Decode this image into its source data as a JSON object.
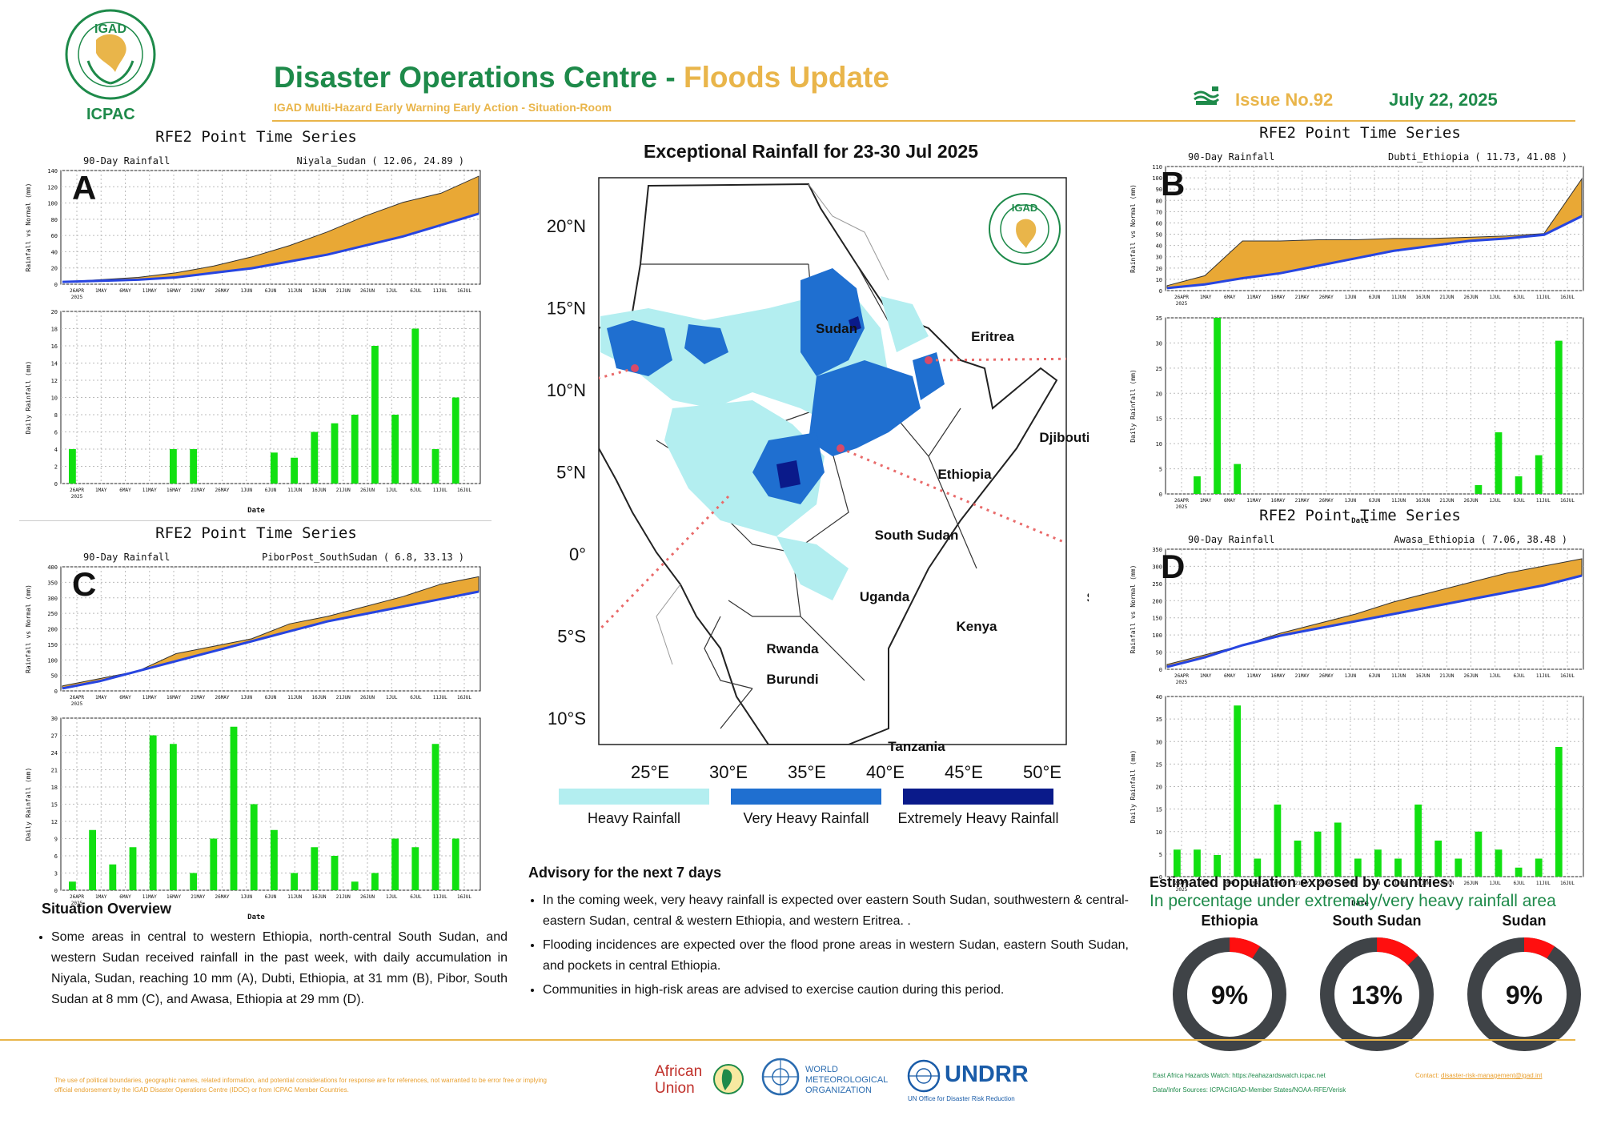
{
  "header": {
    "logo_org": "ICPAC",
    "logo_badge": "IGAD",
    "title_main": "Disaster Operations Centre - ",
    "title_highlight": "Floods Update",
    "subtitle": "IGAD Multi-Hazard Early Warning Early Action - Situation-Room",
    "issue": "Issue No.92",
    "date": "July 22, 2025"
  },
  "map": {
    "title": "Exceptional Rainfall for 23-30 Jul 2025",
    "lat_labels": [
      "20°N",
      "15°N",
      "10°N",
      "5°N",
      "0°",
      "5°S",
      "10°S"
    ],
    "lon_labels": [
      "25°E",
      "30°E",
      "35°E",
      "40°E",
      "45°E",
      "50°E"
    ],
    "countries": [
      "Sudan",
      "Eritrea",
      "Djibouti",
      "Ethiopia",
      "South Sudan",
      "Somalia",
      "Uganda",
      "Kenya",
      "Rwanda",
      "Burundi",
      "Tanzania"
    ],
    "legend": [
      {
        "label": "Heavy Rainfall",
        "color": "#b3eef0"
      },
      {
        "label": "Very Heavy Rainfall",
        "color": "#1f6fd0"
      },
      {
        "label": "Extremely Heavy Rainfall",
        "color": "#0a1a8a"
      }
    ],
    "badge": "IGAD"
  },
  "panels": [
    {
      "letter": "A",
      "heading": "RFE2 Point Time Series",
      "left_label": "90-Day Rainfall",
      "station": "Niyala_Sudan ( 12.06, 24.89 )",
      "ylabel_top": "Rainfall vs Normal (mm)",
      "ylabel_bottom": "Daily Rainfall (mm)",
      "xlabel": "Date",
      "top_ticks": [
        "0",
        "20",
        "40",
        "60",
        "80",
        "100",
        "120",
        "140"
      ],
      "bottom_ticks": [
        "0",
        "2",
        "4",
        "6",
        "8",
        "10",
        "12",
        "14",
        "16",
        "18",
        "20"
      ],
      "dates": [
        "26APR",
        "1MAY",
        "6MAY",
        "11MAY",
        "16MAY",
        "21MAY",
        "26MAY",
        "1JUN",
        "6JUN",
        "11JUN",
        "16JUN",
        "21JUN",
        "26JUN",
        "1JUL",
        "6JUL",
        "11JUL",
        "16JUL"
      ],
      "year": "2025"
    },
    {
      "letter": "B",
      "heading": "RFE2 Point Time Series",
      "left_label": "90-Day Rainfall",
      "station": "Dubti_Ethiopia ( 11.73, 41.08 )",
      "ylabel_top": "Rainfall vs Normal (mm)",
      "ylabel_bottom": "Daily Rainfall (mm)",
      "xlabel": "Date",
      "top_ticks": [
        "0",
        "10",
        "20",
        "30",
        "40",
        "50",
        "60",
        "70",
        "80",
        "90",
        "100",
        "110"
      ],
      "bottom_ticks": [
        "0",
        "5",
        "10",
        "15",
        "20",
        "25",
        "30",
        "35"
      ],
      "dates": [
        "26APR",
        "1MAY",
        "6MAY",
        "11MAY",
        "16MAY",
        "21MAY",
        "26MAY",
        "1JUN",
        "6JUN",
        "11JUN",
        "16JUN",
        "21JUN",
        "26JUN",
        "1JUL",
        "6JUL",
        "11JUL",
        "16JUL"
      ],
      "year": "2025"
    },
    {
      "letter": "C",
      "heading": "RFE2 Point Time Series",
      "left_label": "90-Day Rainfall",
      "station": "PiborPost_SouthSudan ( 6.8, 33.13 )",
      "ylabel_top": "Rainfall vs Normal (mm)",
      "ylabel_bottom": "Daily Rainfall (mm)",
      "xlabel": "Date",
      "top_ticks": [
        "0",
        "50",
        "100",
        "150",
        "200",
        "250",
        "300",
        "350",
        "400"
      ],
      "bottom_ticks": [
        "0",
        "3",
        "6",
        "9",
        "12",
        "15",
        "18",
        "21",
        "24",
        "27",
        "30"
      ],
      "dates": [
        "26APR",
        "1MAY",
        "6MAY",
        "11MAY",
        "16MAY",
        "21MAY",
        "26MAY",
        "1JUN",
        "6JUN",
        "11JUN",
        "16JUN",
        "21JUN",
        "26JUN",
        "1JUL",
        "6JUL",
        "11JUL",
        "16JUL"
      ],
      "year": "2025"
    },
    {
      "letter": "D",
      "heading": "RFE2 Point Time Series",
      "left_label": "90-Day Rainfall",
      "station": "Awasa_Ethiopia ( 7.06, 38.48 )",
      "ylabel_top": "Rainfall vs Normal (mm)",
      "ylabel_bottom": "Daily Rainfall (mm)",
      "xlabel": "Date",
      "top_ticks": [
        "0",
        "50",
        "100",
        "150",
        "200",
        "250",
        "300",
        "350"
      ],
      "bottom_ticks": [
        "0",
        "5",
        "10",
        "15",
        "20",
        "25",
        "30",
        "35",
        "40"
      ],
      "dates": [
        "26APR",
        "1MAY",
        "6MAY",
        "11MAY",
        "16MAY",
        "21MAY",
        "26MAY",
        "1JUN",
        "6JUN",
        "11JUN",
        "16JUN",
        "21JUN",
        "26JUN",
        "1JUL",
        "6JUL",
        "11JUL",
        "16JUL"
      ],
      "year": "2025"
    }
  ],
  "situation": {
    "heading": "Situation Overview",
    "text": "Some areas in central to western Ethiopia, north-central South Sudan, and western Sudan received rainfall in the past week, with daily accumulation in Niyala, Sudan, reaching 10 mm (A), Dubti, Ethiopia, at 31 mm (B), Pibor, South Sudan at 8 mm (C), and  Awasa, Ethiopia at 29 mm (D)."
  },
  "advisory": {
    "heading": "Advisory for the next 7 days",
    "items": [
      "In the coming week, very heavy rainfall is expected over  eastern South Sudan, southwestern & central-eastern Sudan, central & western Ethiopia, and western Eritrea.   .",
      "Flooding incidences are expected over the flood prone areas in western Sudan, eastern South Sudan, and pockets in central Ethiopia.",
      "Communities in high-risk areas are advised to exercise caution during this period."
    ]
  },
  "population": {
    "heading": "Estimated population exposed by countries:",
    "subheading": "In percentage under extremely/very heavy rainfall area",
    "items": [
      {
        "country": "Ethiopia",
        "value": "9%",
        "fraction": 0.09
      },
      {
        "country": "South Sudan",
        "value": "13%",
        "fraction": 0.13
      },
      {
        "country": "Sudan",
        "value": "9%",
        "fraction": 0.09
      }
    ],
    "ring_color": "#3f4347",
    "fill_color": "#ff0f0f"
  },
  "footer": {
    "disclaimer": "The use of political boundaries, geographic names, related information, and potential considerations for response are for references, not warranted to be error free or implying official endorsement by the IGAD Disaster Operations Centre (IDOC) or from ICPAC Member Countries.",
    "au": "African Union",
    "wmo_1": "WORLD",
    "wmo_2": "METEOROLOGICAL",
    "wmo_3": "ORGANIZATION",
    "undrr": "UNDRR",
    "undrr_sub": "UN Office for Disaster Risk Reduction",
    "watch": "East Africa Hazards Watch: https://eahazardswatch.icpac.net",
    "sources": "Data/Infor Sources:  ICPAC/IGAD-Member States/NOAA-RFE/Verisk",
    "contact_label": "Contact: ",
    "contact": "disaster-risk-management@igad.int"
  },
  "colors": {
    "green": "#1e8a4a",
    "gold": "#e9b54a",
    "above": "#e9a835",
    "below": "#2745e0",
    "bar": "#11e011"
  }
}
